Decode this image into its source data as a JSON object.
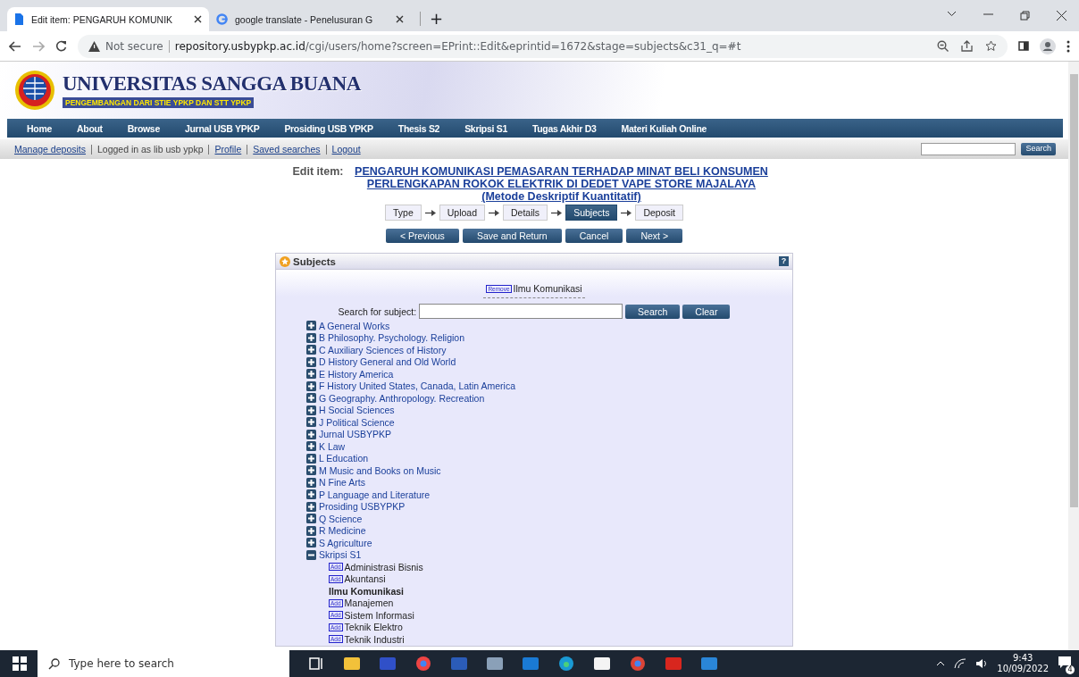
{
  "browser": {
    "tabs": [
      {
        "title": "Edit item: PENGARUH KOMUNIK",
        "selected": true
      },
      {
        "title": "google translate - Penelusuran G",
        "selected": false
      }
    ],
    "new_tab": "+",
    "address": {
      "security": "Not secure",
      "host": "repository.usbypkp.ac.id",
      "path": "/cgi/users/home?screen=EPrint::Edit&eprintid=1672&stage=subjects&c31_q=#t"
    }
  },
  "site": {
    "title": "UNIVERSITAS SANGGA BUANA",
    "subtitle": "PENGEMBANGAN DARI STIE YPKP DAN STT YPKP",
    "nav": [
      "Home",
      "About",
      "Browse",
      "Jurnal USB YPKP",
      "Prosiding USB YPKP",
      "Thesis S2",
      "Skripsi S1",
      "Tugas Akhir D3",
      "Materi Kuliah Online"
    ],
    "user_links": [
      {
        "label": "Manage deposits",
        "kind": "link"
      },
      {
        "label": "Logged in as lib usb ypkp",
        "kind": "text"
      },
      {
        "label": "Profile",
        "kind": "link"
      },
      {
        "label": "Saved searches",
        "kind": "link"
      },
      {
        "label": "Logout",
        "kind": "link"
      }
    ],
    "search_button": "Search"
  },
  "edit": {
    "prefix": "Edit item:",
    "title": "PENGARUH KOMUNIKASI PEMASARAN TERHADAP MINAT BELI KONSUMEN PERLENGKAPAN ROKOK ELEKTRIK DI DEDET VAPE STORE MAJALAYA (Metode Deskriptif Kuantitatif)",
    "stages": [
      {
        "label": "Type",
        "selected": false
      },
      {
        "label": "Upload",
        "selected": false
      },
      {
        "label": "Details",
        "selected": false
      },
      {
        "label": "Subjects",
        "selected": true
      },
      {
        "label": "Deposit",
        "selected": false
      }
    ],
    "actions": [
      "< Previous",
      "Save and Return",
      "Cancel",
      "Next >"
    ]
  },
  "subjects": {
    "heading": "Subjects",
    "help": "?",
    "chosen": [
      {
        "remove": "Remove",
        "label": "Ilmu Komunikasi"
      }
    ],
    "search_label": "Search for subject:",
    "buttons": [
      "Search",
      "Clear"
    ],
    "tree": [
      {
        "label": "A General Works",
        "expanded": false
      },
      {
        "label": "B Philosophy. Psychology. Religion",
        "expanded": false
      },
      {
        "label": "C Auxiliary Sciences of History",
        "expanded": false
      },
      {
        "label": "D History General and Old World",
        "expanded": false
      },
      {
        "label": "E History America",
        "expanded": false
      },
      {
        "label": "F History United States, Canada, Latin America",
        "expanded": false
      },
      {
        "label": "G Geography. Anthropology. Recreation",
        "expanded": false
      },
      {
        "label": "H Social Sciences",
        "expanded": false
      },
      {
        "label": "J Political Science",
        "expanded": false
      },
      {
        "label": "Jurnal USBYPKP",
        "expanded": false
      },
      {
        "label": "K Law",
        "expanded": false
      },
      {
        "label": "L Education",
        "expanded": false
      },
      {
        "label": "M Music and Books on Music",
        "expanded": false
      },
      {
        "label": "N Fine Arts",
        "expanded": false
      },
      {
        "label": "P Language and Literature",
        "expanded": false
      },
      {
        "label": "Prosiding USBYPKP",
        "expanded": false
      },
      {
        "label": "Q Science",
        "expanded": false
      },
      {
        "label": "R Medicine",
        "expanded": false
      },
      {
        "label": "S Agriculture",
        "expanded": false
      },
      {
        "label": "Skripsi S1",
        "expanded": true,
        "children": [
          {
            "label": "Administrasi Bisnis",
            "kind": "add",
            "action": "Add"
          },
          {
            "label": "Akuntansi",
            "kind": "add",
            "action": "Add"
          },
          {
            "label": "Ilmu Komunikasi",
            "kind": "chosen"
          },
          {
            "label": "Manajemen",
            "kind": "add",
            "action": "Add"
          },
          {
            "label": "Sistem Informasi",
            "kind": "add",
            "action": "Add"
          },
          {
            "label": "Teknik Elektro",
            "kind": "add",
            "action": "Add"
          },
          {
            "label": "Teknik Industri",
            "kind": "add",
            "action": "Add"
          }
        ]
      }
    ]
  },
  "taskbar": {
    "search_placeholder": "Type here to search",
    "time": "9:43",
    "date": "10/09/2022",
    "notifications": "4"
  }
}
